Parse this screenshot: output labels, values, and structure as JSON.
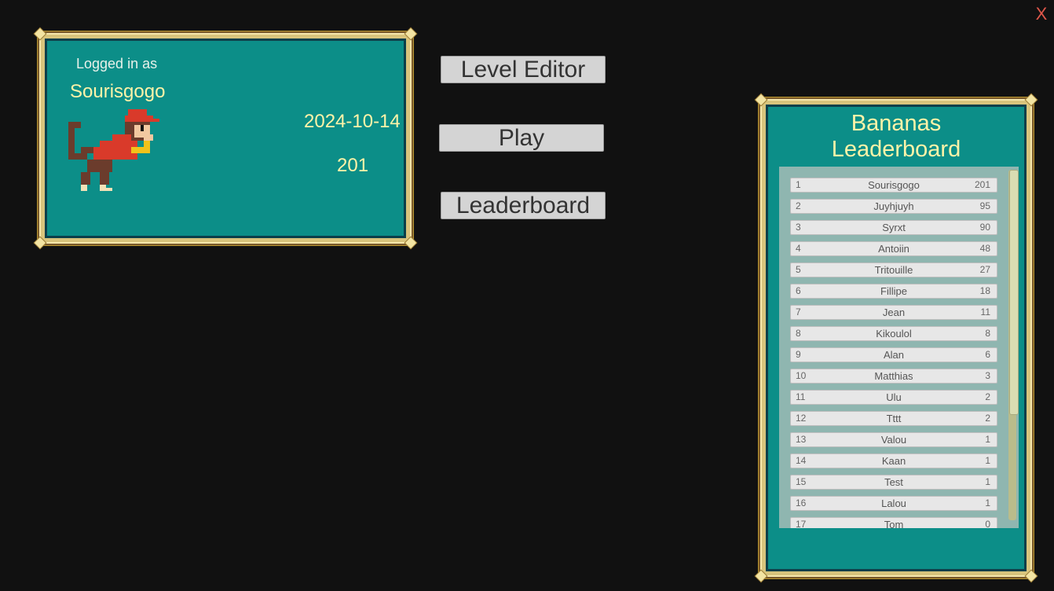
{
  "close": {
    "label": "X"
  },
  "profile": {
    "logged_label": "Logged in as",
    "username": "Sourisgogo",
    "date": "2024-10-14",
    "score": "201"
  },
  "menu": {
    "level_editor": "Level Editor",
    "play": "Play",
    "leaderboard": "Leaderboard"
  },
  "leaderboard": {
    "title_line1": "Bananas",
    "title_line2": "Leaderboard",
    "rows": [
      {
        "rank": "1",
        "name": "Sourisgogo",
        "points": "201"
      },
      {
        "rank": "2",
        "name": "Juyhjuyh",
        "points": "95"
      },
      {
        "rank": "3",
        "name": "Syrxt",
        "points": "90"
      },
      {
        "rank": "4",
        "name": "Antoiin",
        "points": "48"
      },
      {
        "rank": "5",
        "name": "Tritouille",
        "points": "27"
      },
      {
        "rank": "6",
        "name": "Fillipe",
        "points": "18"
      },
      {
        "rank": "7",
        "name": "Jean",
        "points": "11"
      },
      {
        "rank": "8",
        "name": "Kikoulol",
        "points": "8"
      },
      {
        "rank": "9",
        "name": "Alan",
        "points": "6"
      },
      {
        "rank": "10",
        "name": "Matthias",
        "points": "3"
      },
      {
        "rank": "11",
        "name": "Ulu",
        "points": "2"
      },
      {
        "rank": "12",
        "name": "Tttt",
        "points": "2"
      },
      {
        "rank": "13",
        "name": "Valou",
        "points": "1"
      },
      {
        "rank": "14",
        "name": "Kaan",
        "points": "1"
      },
      {
        "rank": "15",
        "name": "Test",
        "points": "1"
      },
      {
        "rank": "16",
        "name": "Lalou",
        "points": "1"
      },
      {
        "rank": "17",
        "name": "Tom",
        "points": "0"
      }
    ]
  },
  "colors": {
    "panel": "#0c8e88",
    "frame_gold": "#d8c47c",
    "title_yellow": "#fff3a8",
    "close_red": "#e0574a"
  },
  "icons": {
    "avatar": "pixel-monkey-icon",
    "close": "close-icon"
  }
}
